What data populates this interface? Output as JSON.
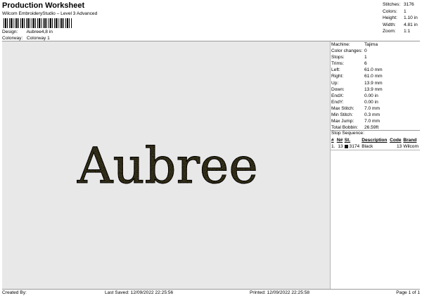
{
  "header": {
    "title": "Production Worksheet",
    "subtitle": "Wilcom EmbroideryStudio – Level 3 Advanced",
    "design_label": "Design:",
    "design_value": "Aubree4,8 in",
    "colorway_label": "Colorway:",
    "colorway_value": "Colorway 1"
  },
  "summary": [
    {
      "label": "Stitches:",
      "value": "3176"
    },
    {
      "label": "Colors:",
      "value": "1"
    },
    {
      "label": "Height:",
      "value": "1.10 in"
    },
    {
      "label": "Width:",
      "value": "4.81 in"
    },
    {
      "label": "Zoom:",
      "value": "1:1"
    }
  ],
  "preview": {
    "text": "Aubree",
    "thread_color": "#3a3729",
    "background_color": "#e8e8e8"
  },
  "machine_info": [
    {
      "label": "Machine:",
      "value": "Tajima"
    },
    {
      "label": "Color changes:",
      "value": "0"
    },
    {
      "label": "Stops:",
      "value": "1"
    },
    {
      "label": "Trims:",
      "value": "6"
    },
    {
      "label": "Left:",
      "value": "61.0 mm"
    },
    {
      "label": "Right:",
      "value": "61.0 mm"
    },
    {
      "label": "Up:",
      "value": "13.9 mm"
    },
    {
      "label": "Down:",
      "value": "13.9 mm"
    },
    {
      "label": "EndX:",
      "value": "0.00 in"
    },
    {
      "label": "EndY:",
      "value": "0.00 in"
    },
    {
      "label": "Max Stitch:",
      "value": "7.0 mm"
    },
    {
      "label": "Min Stitch:",
      "value": "0.3 mm"
    },
    {
      "label": "Max Jump:",
      "value": "7.0 mm"
    },
    {
      "label": "Total Bobbin:",
      "value": "26.59ft"
    }
  ],
  "stop_sequence": {
    "title": "Stop Sequence:",
    "headers": [
      "#",
      "N#",
      "St.",
      "Description",
      "Code",
      "Brand"
    ],
    "rows": [
      {
        "num": "1.",
        "n": "13",
        "color": "#111111",
        "stitches": "3174",
        "description": "Black",
        "code": "13",
        "brand": "Wilcom"
      }
    ]
  },
  "footer": {
    "created_by": "Created By:",
    "last_saved": "Last Saved: 12/09/2022 22:25:56",
    "printed": "Printed: 12/09/2022 22:25:58",
    "page": "Page 1 of 1"
  }
}
